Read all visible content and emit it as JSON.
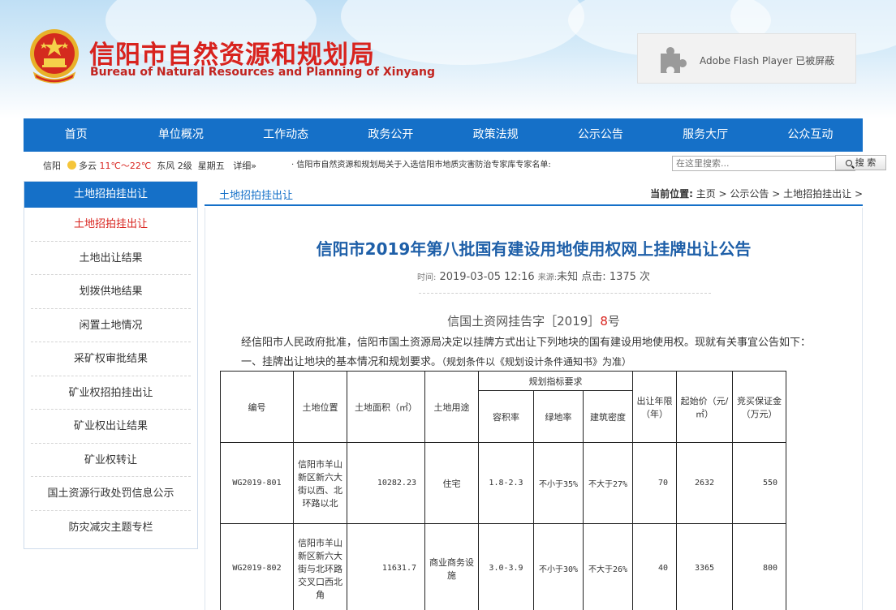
{
  "header": {
    "title": "信阳市自然资源和规划局",
    "subtitle": "Bureau of Natural Resources and Planning of Xinyang",
    "flash_notice": "Adobe Flash Player 已被屏蔽"
  },
  "nav": {
    "items": [
      "首页",
      "单位概况",
      "工作动态",
      "政务公开",
      "政策法规",
      "公示公告",
      "服务大厅",
      "公众互动"
    ]
  },
  "infobar": {
    "city": "信阳",
    "weather": "多云",
    "temperature": "11℃～22℃",
    "wind": "东风 2级",
    "weekday": "星期五",
    "details": "详细»",
    "ticker": "· 信阳市自然资源和规划局关于入选信阳市地质灾害防治专家库专家名单:",
    "search_placeholder": "在这里搜索...",
    "search_button": "搜 索"
  },
  "sidebar": {
    "heading": "土地招拍挂出让",
    "items": [
      "土地招拍挂出让",
      "土地出让结果",
      "划拨供地结果",
      "闲置土地情况",
      "采矿权审批结果",
      "矿业权招拍挂出让",
      "矿业权出让结果",
      "矿业权转让",
      "国土资源行政处罚信息公示",
      "防灾减灾主题专栏"
    ]
  },
  "main": {
    "section_title": "土地招拍挂出让",
    "breadcrumb": {
      "label": "当前位置:",
      "items": [
        "主页",
        "公示公告",
        "土地招拍挂出让"
      ],
      "sep": " > "
    },
    "article": {
      "title": "信阳市2019年第八批国有建设用地使用权网上挂牌出让公告",
      "time_label": "时间:",
      "time": "2019-03-05 12:16",
      "source_label": "来源:",
      "source": "未知",
      "clicks_label": "点击:",
      "clicks": "1375 次",
      "doc_no_prefix": "信国土资网挂告字［2019］",
      "doc_no_num": "8",
      "doc_no_suffix": "号",
      "para1": "经信阳市人民政府批准，信阳市国土资源局决定以挂牌方式出让下列地块的国有建设用地使用权。现就有关事宜公告如下：",
      "para2_main": "一、挂牌出让地块的基本情况和规划要求。",
      "para2_note": "（规划条件以《规划设计条件通知书》为准）"
    }
  },
  "table": {
    "headers": {
      "id": "编号",
      "location": "土地位置",
      "area": "土地面积（㎡）",
      "use": "土地用途",
      "planning": "规划指标要求",
      "far": "容积率",
      "green": "绿地率",
      "density": "建筑密度",
      "term": "出让年限（年）",
      "start_price": "起始价（元/㎡）",
      "deposit": "竞买保证金（万元）"
    },
    "rows": [
      {
        "id": "WG2019-801",
        "location": "信阳市羊山新区新六大街以西、北环路以北",
        "area": "10282.23",
        "use": "住宅",
        "far": "1.8-2.3",
        "green": "不小于35%",
        "density": "不大于27%",
        "term": "70",
        "start_price": "2632",
        "deposit": "550"
      },
      {
        "id": "WG2019-802",
        "location": "信阳市羊山新区新六大街与北环路交叉口西北角",
        "area": "11631.7",
        "use": "商业商务设施",
        "far": "3.0-3.9",
        "green": "不小于30%",
        "density": "不大于26%",
        "term": "40",
        "start_price": "3365",
        "deposit": "800"
      }
    ]
  },
  "colors": {
    "nav_blue": "#1570c8",
    "title_red": "#d8231e",
    "article_title_blue": "#1e5fa8"
  },
  "icons": [
    "national-emblem-icon",
    "puzzle-plugin-icon",
    "weather-cloudy-icon",
    "search-icon"
  ]
}
